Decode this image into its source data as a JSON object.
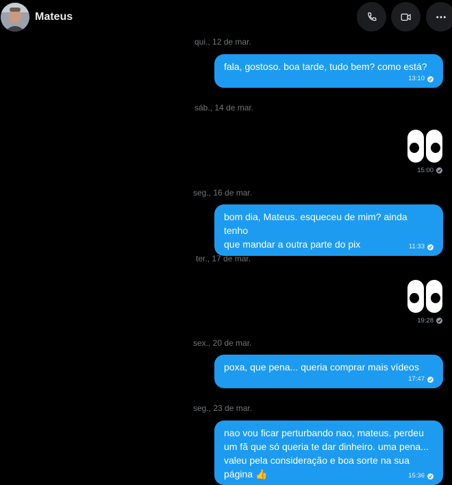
{
  "header": {
    "contact_name": "Mateus",
    "avatar_icon": "user-avatar",
    "actions": [
      "phone-icon",
      "video-camera-icon",
      "more-options-icon"
    ]
  },
  "colors": {
    "bubble": "#1d9bf0",
    "background": "#000000",
    "date_text": "#71767b"
  },
  "messages": [
    {
      "date": "qui., 12 de mar.",
      "text": "fala, gostoso. boa tarde, tudo bem? como está?",
      "time": "13:10"
    },
    {
      "date": "sáb., 14 de mar.",
      "emoji": "eyes",
      "time": "15:00"
    },
    {
      "date": "seg., 16 de mar.",
      "text": "bom dia, Mateus. esqueceu de mim? ainda tenho\nque mandar a outra parte do pix",
      "time": "11:33"
    },
    {
      "date": "ter., 17 de mar.",
      "emoji": "eyes",
      "time": "19:28"
    },
    {
      "date": "sex., 20 de mar.",
      "text": "poxa, que pena... queria comprar mais vídeos",
      "time": "17:47"
    },
    {
      "date": "seg., 23 de mar.",
      "text": "nao vou ficar perturbando nao, mateus. perdeu\num fã que só queria te dar dinheiro. uma pena...\nvaleu pela consideração e boa sorte na sua\npágina",
      "emoji_suffix": "👍",
      "time": "15:36"
    }
  ]
}
